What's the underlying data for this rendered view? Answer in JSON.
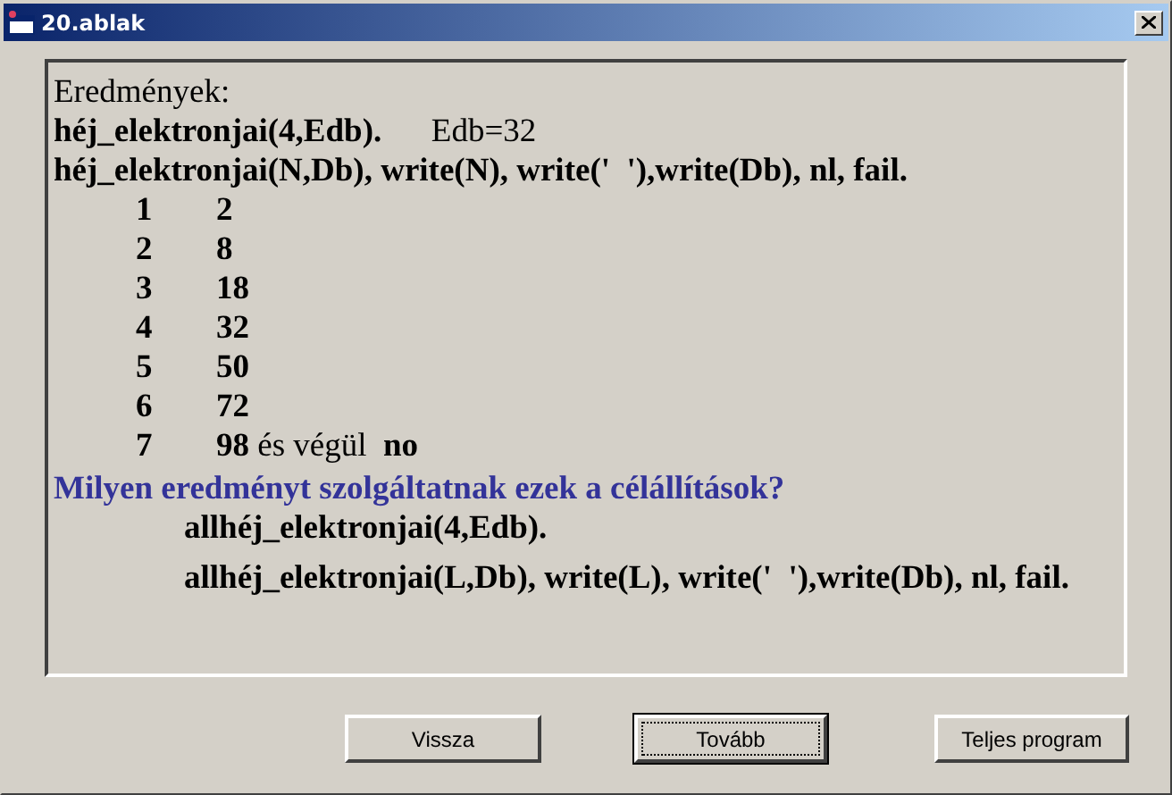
{
  "window": {
    "title": "20.ablak"
  },
  "heading": "Eredmények:",
  "lines": [
    "**héj_elektronjai(4,Edb).**      Edb=32",
    "**héj_elektronjai(N,Db), write(N), write('  '),write(Db), nl, fail.**"
  ],
  "table": [
    {
      "n": "1",
      "value": "**2**"
    },
    {
      "n": "2",
      "value": "**8**"
    },
    {
      "n": "3",
      "value": "**18**"
    },
    {
      "n": "4",
      "value": "**32**"
    },
    {
      "n": "5",
      "value": "**50**"
    },
    {
      "n": "6",
      "value": "**72**"
    },
    {
      "n": "7",
      "value": "**98** és végül  **no**"
    }
  ],
  "question": "Milyen eredményt szolgáltatnak ezek a célállítások?",
  "goals": [
    "allhéj_elektronjai(4,Edb).",
    "allhéj_elektronjai(L,Db), write(L), write('  '),write(Db), nl, fail."
  ],
  "buttons": [
    {
      "label": "Vissza",
      "focused": false
    },
    {
      "label": "Tovább",
      "focused": true
    },
    {
      "label": "Teljes program",
      "focused": false
    }
  ]
}
